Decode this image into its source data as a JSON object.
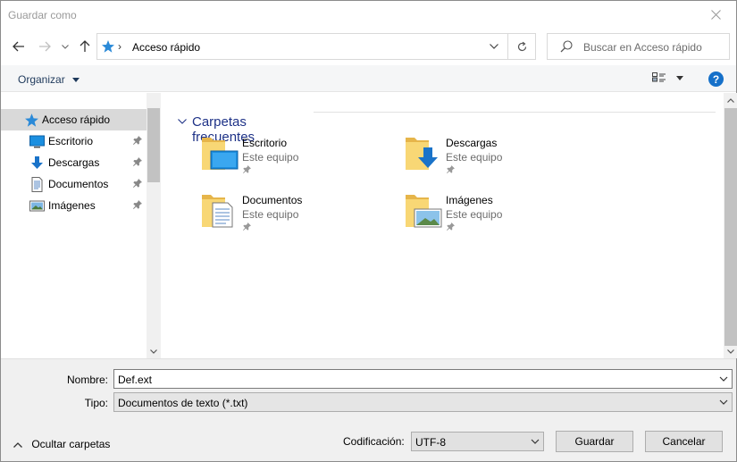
{
  "window": {
    "title": "Guardar como"
  },
  "address": {
    "location": "Acceso rápido",
    "separator": "›"
  },
  "search": {
    "placeholder": "Buscar en Acceso rápido"
  },
  "toolbar": {
    "organize_label": "Organizar",
    "help_label": "?"
  },
  "nav": {
    "items": [
      {
        "label": "Acceso rápido",
        "icon": "star-icon",
        "pinned": false
      },
      {
        "label": "Escritorio",
        "icon": "desktop-icon",
        "pinned": true
      },
      {
        "label": "Descargas",
        "icon": "download-icon",
        "pinned": true
      },
      {
        "label": "Documentos",
        "icon": "document-icon",
        "pinned": true
      },
      {
        "label": "Imágenes",
        "icon": "pictures-icon",
        "pinned": true
      }
    ]
  },
  "content": {
    "group_title": "Carpetas frecuentes",
    "folders": [
      {
        "name": "Escritorio",
        "location": "Este equipo",
        "icon": "desktop-folder-icon"
      },
      {
        "name": "Descargas",
        "location": "Este equipo",
        "icon": "downloads-folder-icon"
      },
      {
        "name": "Documentos",
        "location": "Este equipo",
        "icon": "documents-folder-icon"
      },
      {
        "name": "Imágenes",
        "location": "Este equipo",
        "icon": "pictures-folder-icon"
      }
    ]
  },
  "form": {
    "name_label": "Nombre:",
    "name_value": "Def.ext",
    "type_label": "Tipo:",
    "type_value": "Documentos de texto (*.txt)",
    "encoding_label": "Codificación:",
    "encoding_value": "UTF-8"
  },
  "footer": {
    "hide_folders_label": "Ocultar carpetas",
    "save_label": "Guardar",
    "cancel_label": "Cancelar"
  },
  "colors": {
    "accent": "#1570c9",
    "group_header": "#1e3287",
    "folder": "#f8d775",
    "selected": "#d9d9d9"
  }
}
